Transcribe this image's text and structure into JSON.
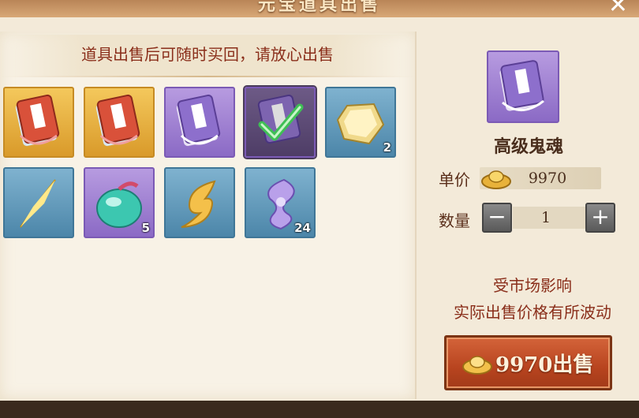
{
  "window": {
    "title": "元宝道具出售",
    "close": "✕"
  },
  "notice": "道具出售后可随时买回，请放心出售",
  "inventory": [
    {
      "name": "skill-book-gold",
      "rarity": "gold",
      "icon": "skill-book-icon",
      "count": ""
    },
    {
      "name": "skill-book-gold",
      "rarity": "gold",
      "icon": "skill-book-icon",
      "count": ""
    },
    {
      "name": "skill-book-purple",
      "rarity": "purple",
      "icon": "skill-book-icon",
      "count": ""
    },
    {
      "name": "skill-book-purple-selected",
      "rarity": "purple",
      "icon": "skill-book-icon",
      "count": "",
      "selected": true
    },
    {
      "name": "gold-gem",
      "rarity": "blue",
      "icon": "gem-icon",
      "count": "2"
    },
    {
      "name": "gold-crystal",
      "rarity": "blue",
      "icon": "crystal-icon",
      "count": ""
    },
    {
      "name": "spirit-fruit",
      "rarity": "purple",
      "icon": "fruit-icon",
      "count": "5"
    },
    {
      "name": "gold-feather",
      "rarity": "blue",
      "icon": "feather-icon",
      "count": ""
    },
    {
      "name": "purple-swirl",
      "rarity": "blue",
      "icon": "swirl-icon",
      "count": "24"
    }
  ],
  "detail": {
    "item_name": "高级鬼魂",
    "price_label": "单价",
    "price": "9970",
    "quantity_label": "数量",
    "quantity": "1",
    "minus": "−",
    "plus": "+",
    "note_line1": "受市场影响",
    "note_line2": "实际出售价格有所波动",
    "sell_button": "9970出售"
  },
  "colors": {
    "accent": "#8a2e1a",
    "button": "#c0502a",
    "gold": "#e8b23a",
    "purple": "#9a7bd0",
    "blue": "#5f98bb"
  }
}
